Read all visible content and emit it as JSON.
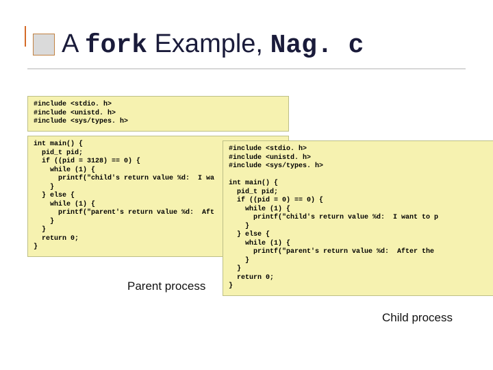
{
  "title": {
    "pre": "A ",
    "mono1": "fork",
    "mid": " Example, ",
    "mono2": "Nag. c"
  },
  "includes_code": "#include <stdio. h>\n#include <unistd. h>\n#include <sys/types. h>",
  "parent_code": "int main() {\n  pid_t pid;\n  if ((pid = 3128) == 0) {\n    while (1) {\n      printf(\"child's return value %d:  I wa\n    }\n  } else {\n    while (1) {\n      printf(\"parent's return value %d:  Aft\n    }\n  }\n  return 0;\n}",
  "child_code": "#include <stdio. h>\n#include <unistd. h>\n#include <sys/types. h>\n\nint main() {\n  pid_t pid;\n  if ((pid = 0) == 0) {\n    while (1) {\n      printf(\"child's return value %d:  I want to p\n    }\n  } else {\n    while (1) {\n      printf(\"parent's return value %d:  After the\n    }\n  }\n  return 0;\n}",
  "captions": {
    "parent": "Parent process",
    "child": "Child process"
  }
}
